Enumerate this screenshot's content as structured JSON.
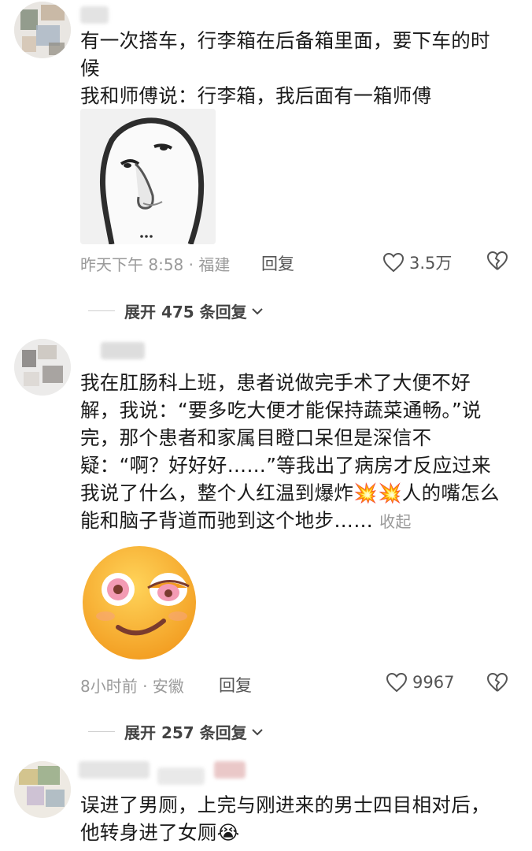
{
  "comments": [
    {
      "text": "有一次搭车，行李箱在后备箱里面，要下车的时候\n我和师傅说：行李箱，我后面有一箱师傅",
      "sticker": "sketch-face-sticker",
      "time_location": "昨天下午 8:58 · 福建",
      "reply_label": "回复",
      "likes": "3.5万",
      "expand_replies": "展开 475 条回复"
    },
    {
      "text": "我在肛肠科上班，患者说做完手术了大便不好解，我说：“要多吃大便才能保持蔬菜通畅。”说完，那个患者和家属目瞪口呆但是深信不疑：“啊？好好好……”等我出了病房才反应过来我说了什么，整个人红温到爆炸💥💥人的嘴怎么能和脑子背道而驰到这个地步……",
      "collapse_label": "收起",
      "sticker": "blushing-emoji-sticker",
      "time_location": "8小时前 · 安徽",
      "reply_label": "回复",
      "likes": "9967",
      "expand_replies": "展开 257 条回复"
    },
    {
      "text": "误进了男厕，上完与刚进来的男士四目相对后，他转身进了女厕😭"
    }
  ],
  "colors": {
    "meta": "#9a9a9a",
    "text": "#1a1a1a",
    "emoji_face": "#f6b534"
  }
}
